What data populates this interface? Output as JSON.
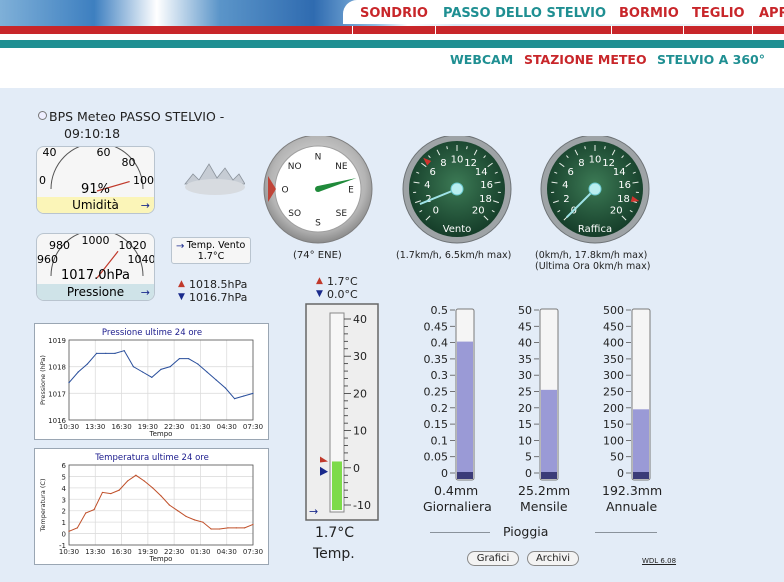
{
  "nav": {
    "top": [
      {
        "label": "SONDRIO"
      },
      {
        "label": "PASSO DELLO STELVIO"
      },
      {
        "label": "BORMIO"
      },
      {
        "label": "TEGLIO"
      },
      {
        "label": "APR"
      }
    ],
    "sub": [
      {
        "label": "WEBCAM"
      },
      {
        "label": "STAZIONE METEO"
      },
      {
        "label": "STELVIO A 360°"
      }
    ],
    "active_sub": "STAZIONE METEO"
  },
  "station": {
    "title_line1": "BPS Meteo PASSO STELVIO -",
    "title_line2": "09:10:18"
  },
  "humidity": {
    "ticks": [
      "0",
      "40",
      "60",
      "80",
      "100"
    ],
    "value": 91,
    "value_text": "91%",
    "label": "Umidità"
  },
  "pressure": {
    "ticks": [
      "960",
      "980",
      "1000",
      "1020",
      "1040"
    ],
    "value": 1017.0,
    "value_text": "1017.0hPa",
    "label": "Pressione",
    "high_text": "1018.5hPa",
    "low_text": "1016.7hPa"
  },
  "wind_temp": {
    "label": "Temp. Vento",
    "value_text": "1.7°C"
  },
  "compass": {
    "directions": [
      "N",
      "NE",
      "E",
      "SE",
      "S",
      "SO",
      "O",
      "NO"
    ],
    "bearing": 74,
    "caption": "(74° ENE)"
  },
  "wind": {
    "ticks": [
      "0",
      "2",
      "4",
      "6",
      "8",
      "10",
      "12",
      "14",
      "16",
      "18",
      "20"
    ],
    "label": "Vento",
    "value": 1.7,
    "max": 6.5,
    "caption": "(1.7km/h, 6.5km/h max)"
  },
  "gust": {
    "ticks": [
      "0",
      "2",
      "4",
      "6",
      "8",
      "10",
      "12",
      "14",
      "16",
      "18",
      "20"
    ],
    "label": "Raffica",
    "value": 0,
    "max": 17.8,
    "caption1": "(0km/h, 17.8km/h max)",
    "caption2": "(Ultima Ora 0km/h max)"
  },
  "thermo": {
    "high_text": "1.7°C",
    "low_text": "0.0°C",
    "ticks": [
      "40",
      "30",
      "20",
      "10",
      "0",
      "-10"
    ],
    "value": 1.7,
    "value_text": "1.7°C",
    "label": "Temp."
  },
  "rain": {
    "daily": {
      "ticks": [
        "0.5",
        "0.45",
        "0.4",
        "0.35",
        "0.3",
        "0.25",
        "0.2",
        "0.15",
        "0.1",
        "0.05",
        "0"
      ],
      "max": 0.5,
      "fill": 0.4,
      "value_text": "0.4mm",
      "label": "Giornaliera"
    },
    "monthly": {
      "ticks": [
        "50",
        "45",
        "40",
        "35",
        "30",
        "25",
        "20",
        "15",
        "10",
        "5",
        "0"
      ],
      "max": 50,
      "fill": 25.2,
      "value_text": "25.2mm",
      "label": "Mensile"
    },
    "yearly": {
      "ticks": [
        "500",
        "450",
        "400",
        "350",
        "300",
        "250",
        "200",
        "150",
        "100",
        "50",
        "0"
      ],
      "max": 500,
      "fill": 192.3,
      "value_text": "192.3mm",
      "label": "Annuale"
    },
    "label": "Pioggia"
  },
  "buttons": {
    "charts": "Grafici",
    "archive": "Archivi"
  },
  "version": "WDL 6.08",
  "chart_data": [
    {
      "type": "line",
      "title": "Pressione ultime 24 ore",
      "xlabel": "Tempo",
      "ylabel": "Pressione (hPa)",
      "categories": [
        "10:30",
        "13:30",
        "16:30",
        "19:30",
        "22:30",
        "01:30",
        "04:30",
        "07:30"
      ],
      "x_ticks": [
        "10:30",
        "13:30",
        "16:30",
        "19:30",
        "22:30",
        "01:30",
        "04:30",
        "07:30"
      ],
      "y_ticks": [
        "1016",
        "1017",
        "1018",
        "1019"
      ],
      "ylim": [
        1016,
        1019
      ],
      "color": "#2a4f9c",
      "values": [
        1017.4,
        1017.8,
        1018.1,
        1018.5,
        1018.5,
        1018.5,
        1018.6,
        1018.0,
        1017.8,
        1017.6,
        1017.9,
        1018.0,
        1018.3,
        1018.3,
        1018.1,
        1017.8,
        1017.5,
        1017.2,
        1016.8,
        1016.9,
        1017.0
      ]
    },
    {
      "type": "line",
      "title": "Temperatura ultime 24 ore",
      "xlabel": "Tempo",
      "ylabel": "Temperatura (C)",
      "categories": [
        "10:30",
        "13:30",
        "16:30",
        "19:30",
        "22:30",
        "01:30",
        "04:30",
        "07:30"
      ],
      "x_ticks": [
        "10:30",
        "13:30",
        "16:30",
        "19:30",
        "22:30",
        "01:30",
        "04:30",
        "07:30"
      ],
      "y_ticks": [
        "-1",
        "0",
        "1",
        "2",
        "3",
        "4",
        "5",
        "6"
      ],
      "ylim": [
        -1,
        6
      ],
      "color": "#c0502a",
      "values": [
        0.2,
        0.5,
        1.8,
        2.1,
        3.6,
        3.5,
        3.8,
        4.6,
        5.1,
        4.6,
        4.0,
        3.3,
        2.5,
        2.0,
        1.5,
        1.2,
        1.0,
        0.4,
        0.4,
        0.5,
        0.5,
        0.5,
        0.8
      ]
    }
  ]
}
